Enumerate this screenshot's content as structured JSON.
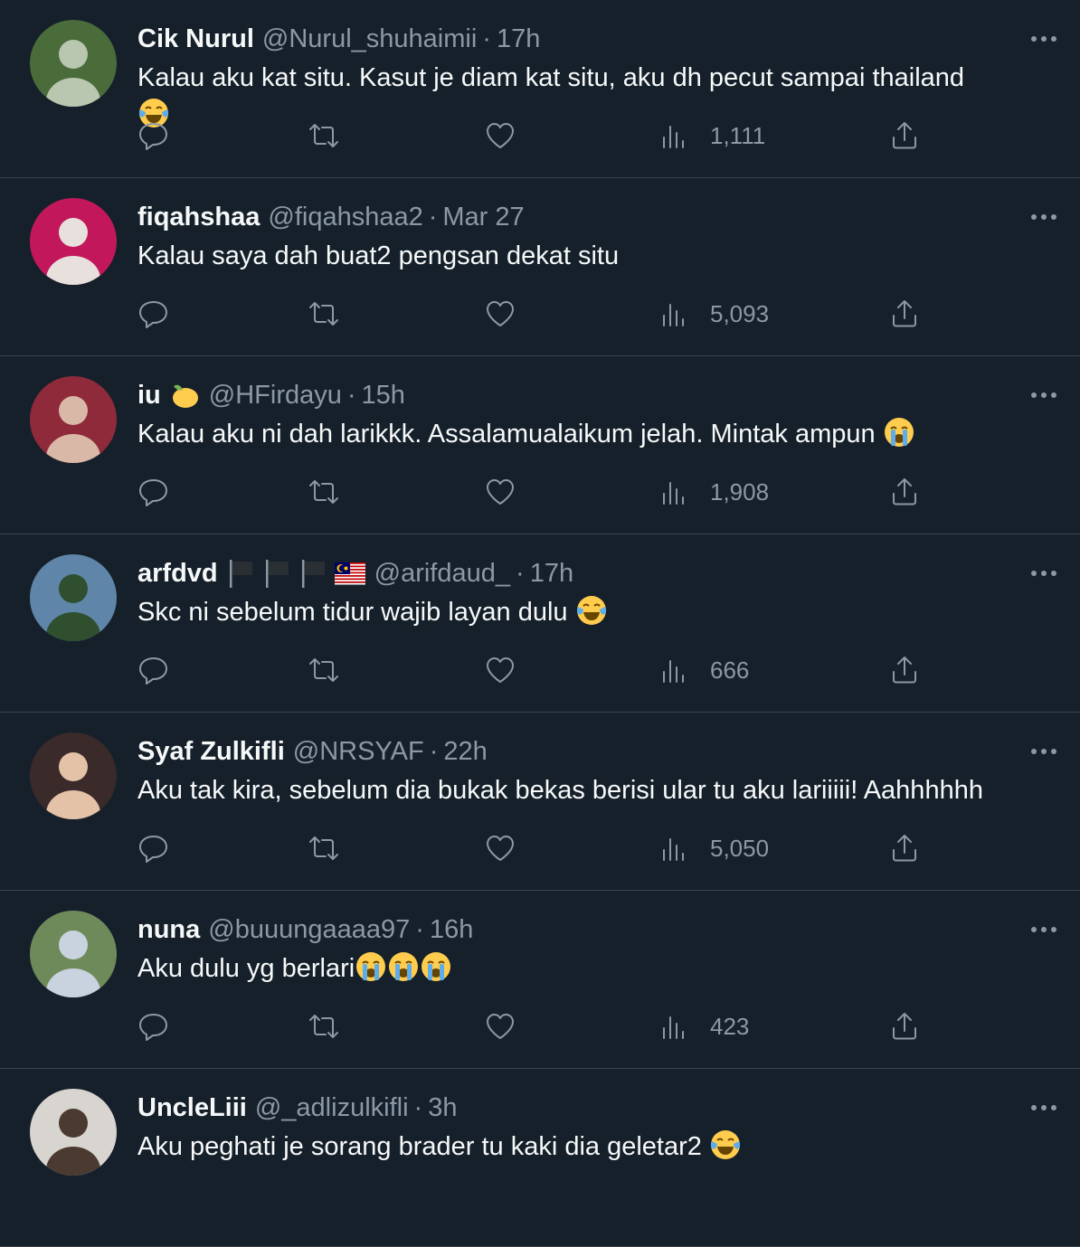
{
  "tweets": [
    {
      "name": "Cik Nurul",
      "handle": "@Nurul_shuhaimii",
      "separator": "·",
      "time": "17h",
      "text": "Kalau aku kat situ. Kasut je diam kat situ, aku dh pecut sampai thailand",
      "trailing_emoji": [
        "face-with-tears-of-joy-icon"
      ],
      "emoji_on_new_line": true,
      "badges": [],
      "views": "1,111",
      "avatar_colors": [
        "#4a6b3a",
        "#b9c6b0"
      ]
    },
    {
      "name": "fiqahshaa",
      "handle": "@fiqahshaa2",
      "separator": "·",
      "time": "Mar 27",
      "text": "Kalau saya dah buat2 pengsan dekat situ",
      "trailing_emoji": [],
      "emoji_on_new_line": false,
      "badges": [],
      "views": "5,093",
      "avatar_colors": [
        "#c2185b",
        "#e8e0dc"
      ]
    },
    {
      "name": "iu",
      "handle": "@HFirdayu",
      "separator": "·",
      "time": "15h",
      "text": "Kalau aku ni dah larikkk. Assalamualaikum jelah. Mintak ampun ",
      "trailing_emoji": [
        "loudly-crying-face-icon"
      ],
      "emoji_on_new_line": false,
      "badges": [
        "lemon-emoji-icon"
      ],
      "views": "1,908",
      "avatar_colors": [
        "#8e2a3a",
        "#d9b8a8"
      ]
    },
    {
      "name": "arfdvd",
      "handle": "@arifdaud_",
      "separator": "·",
      "time": "17h",
      "text": "Skc ni sebelum tidur wajib layan dulu ",
      "trailing_emoji": [
        "face-with-tears-of-joy-icon"
      ],
      "emoji_on_new_line": false,
      "badges": [
        "black-flag-icon",
        "black-flag-icon",
        "black-flag-icon",
        "malaysia-flag-icon"
      ],
      "views": "666",
      "avatar_colors": [
        "#5f86a8",
        "#2f4f2f"
      ]
    },
    {
      "name": "Syaf Zulkifli",
      "handle": "@NRSYAF",
      "separator": "·",
      "time": "22h",
      "text": "Aku tak kira, sebelum dia bukak bekas berisi ular tu aku lariiiii! Aahhhhhh",
      "trailing_emoji": [],
      "emoji_on_new_line": false,
      "badges": [],
      "views": "5,050",
      "avatar_colors": [
        "#3a2a2a",
        "#e3c2a7"
      ]
    },
    {
      "name": "nuna",
      "handle": "@buuungaaaa97",
      "separator": "·",
      "time": "16h",
      "text": "Aku dulu yg berlari",
      "trailing_emoji": [
        "loudly-crying-face-icon",
        "loudly-crying-face-icon",
        "loudly-crying-face-icon"
      ],
      "emoji_on_new_line": false,
      "badges": [],
      "views": "423",
      "avatar_colors": [
        "#6f8a5a",
        "#c8d3df"
      ]
    },
    {
      "name": "UncleLiii",
      "handle": "@_adlizulkifli",
      "separator": "·",
      "time": "3h",
      "text": "Aku peghati je sorang brader tu kaki dia geletar2 ",
      "trailing_emoji": [
        "face-with-tears-of-joy-icon"
      ],
      "emoji_on_new_line": false,
      "badges": [],
      "views": "",
      "avatar_colors": [
        "#d8d4cf",
        "#4a3a30"
      ]
    }
  ],
  "colors": {
    "background": "#15202b",
    "divider": "#38444d",
    "text_primary": "#f7f9f9",
    "text_secondary": "#8b98a5"
  }
}
